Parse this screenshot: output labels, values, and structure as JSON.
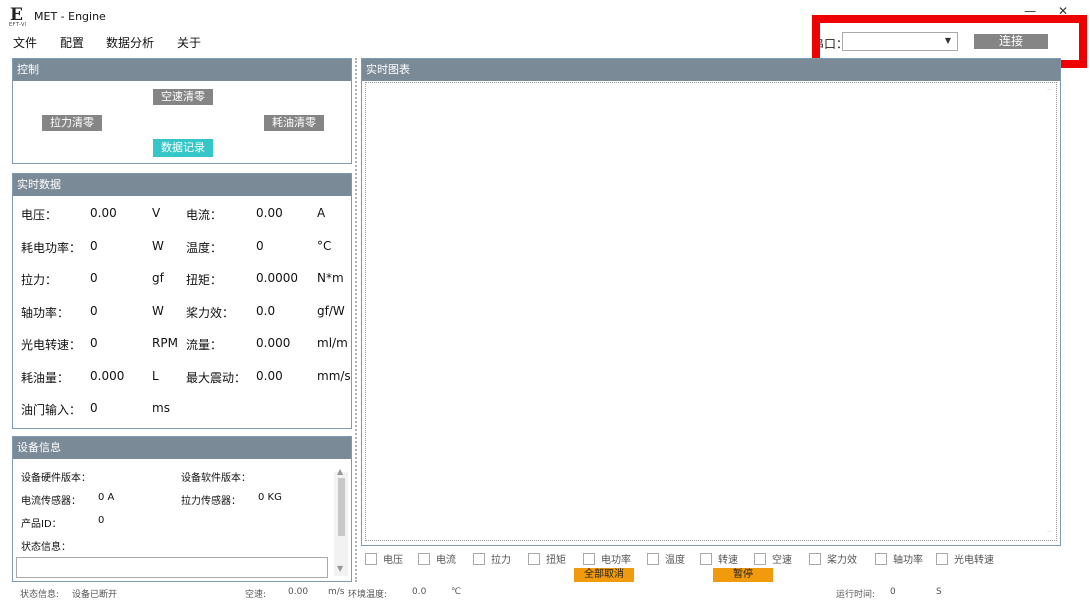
{
  "window": {
    "logo_letter": "E",
    "logo_sub": "EFT-VI",
    "title": "MET - Engine",
    "minimize": "—",
    "close": "✕"
  },
  "menu": [
    "文件",
    "配置",
    "数据分析",
    "关于"
  ],
  "port": {
    "label": "串口：",
    "selected": "",
    "connect_label": "连接"
  },
  "control": {
    "title": "控制",
    "airspeed_zero": "空速清零",
    "pull_zero": "拉力清零",
    "fuel_zero": "耗油清零",
    "record": "数据记录"
  },
  "realtime": {
    "title": "实时数据",
    "rows": [
      {
        "l1": "电压：",
        "v1": "0.00",
        "u1": "V",
        "l2": "电流：",
        "v2": "0.00",
        "u2": "A"
      },
      {
        "l1": "耗电功率：",
        "v1": "0",
        "u1": "W",
        "l2": "温度：",
        "v2": "0",
        "u2": "°C"
      },
      {
        "l1": "拉力：",
        "v1": "0",
        "u1": "gf",
        "l2": "扭矩：",
        "v2": "0.0000",
        "u2": "N*m"
      },
      {
        "l1": "轴功率：",
        "v1": "0",
        "u1": "W",
        "l2": "桨力效：",
        "v2": "0.0",
        "u2": "gf/W"
      },
      {
        "l1": "光电转速：",
        "v1": "0",
        "u1": "RPM",
        "l2": "流量：",
        "v2": "0.000",
        "u2": "ml/m"
      },
      {
        "l1": "耗油量：",
        "v1": "0.000",
        "u1": "L",
        "l2": "最大震动：",
        "v2": "0.00",
        "u2": "mm/s"
      },
      {
        "l1": "油门输入：",
        "v1": "0",
        "u1": "ms",
        "l2": "",
        "v2": "",
        "u2": ""
      }
    ]
  },
  "device": {
    "title": "设备信息",
    "hw_label": "设备硬件版本：",
    "sw_label": "设备软件版本：",
    "current_sensor_label": "电流传感器：",
    "current_sensor_value": "0  A",
    "pull_sensor_label": "拉力传感器：",
    "pull_sensor_value": "0  KG",
    "product_id_label": "产品ID：",
    "product_id_value": "0",
    "status_label": "状态信息："
  },
  "chart": {
    "title": "实时图表",
    "checkboxes": [
      "电压",
      "电流",
      "拉力",
      "扭矩",
      "电功率",
      "温度",
      "转速",
      "空速",
      "桨力效",
      "轴功率",
      "光电转速"
    ],
    "cancel_all": "全部取消",
    "pause": "暂停"
  },
  "statusbar": {
    "status_label": "状态信息:",
    "status_value": "设备已断开",
    "airspeed_label": "空速:",
    "airspeed_value": "0.00",
    "airspeed_unit": "m/s",
    "env_temp_label": "环境温度:",
    "env_temp_value": "0.0",
    "env_temp_unit": "℃",
    "runtime_label": "运行时间:",
    "runtime_value": "0",
    "runtime_unit": "S"
  },
  "colors": {
    "panel_header": "#7a8a97",
    "gray_button": "#858585",
    "teal_button": "#35c7c7",
    "orange_button": "#f09a0c",
    "highlight_red": "#ee0000"
  }
}
